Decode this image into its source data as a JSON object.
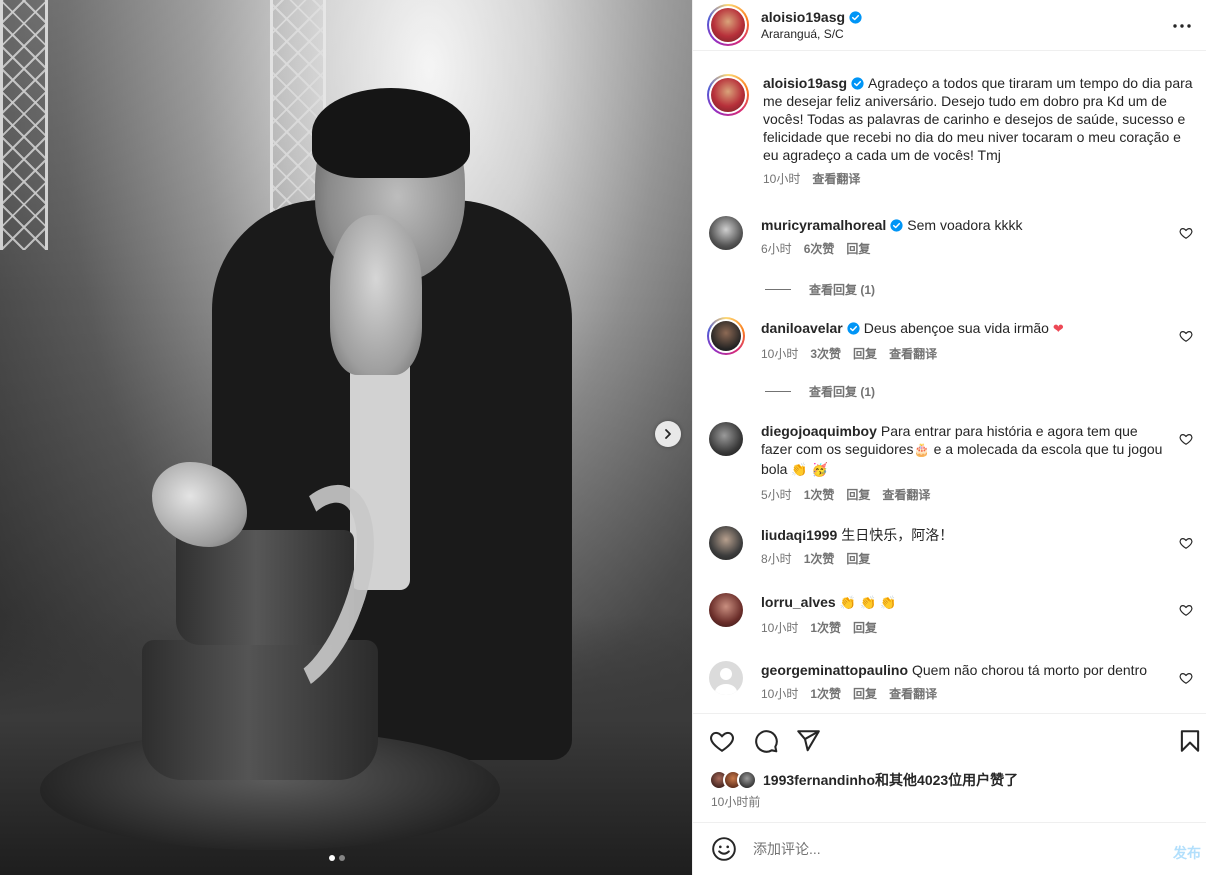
{
  "post": {
    "username": "aloisio19asg",
    "location": "Araranguá, S/C",
    "caption": "Agradeço a todos que tiraram um tempo do dia para me desejar feliz aniversário. Desejo tudo em dobro pra Kd um de vocês! Todas as palavras de carinho e desejos de saúde, sucesso e felicidade que recebi no dia do meu niver tocaram o meu coração e eu agradeço a cada um de vocês! Tmj",
    "caption_time": "10小时",
    "caption_translate": "查看翻译"
  },
  "comments": [
    {
      "user": "muricyramalhoreal",
      "verified": true,
      "text": "Sem voadora kkkk",
      "time": "6小时",
      "likes": "6次赞",
      "reply": "回复",
      "translate": "",
      "view_replies": "查看回复 (1)"
    },
    {
      "user": "daniloavelar",
      "verified": true,
      "text": "Deus abençoe sua vida irmão",
      "emoji": "❤",
      "time": "10小时",
      "likes": "3次赞",
      "reply": "回复",
      "translate": "查看翻译",
      "view_replies": "查看回复 (1)"
    },
    {
      "user": "diegojoaquimboy",
      "verified": false,
      "text_a": "Para entrar para história e agora tem que fazer com os seguidores",
      "emoji_a": "🎂",
      "text_b": " e a molecada da escola que tu jogou bola",
      "emoji_b": "👏 🥳",
      "time": "5小时",
      "likes": "1次赞",
      "reply": "回复",
      "translate": "查看翻译"
    },
    {
      "user": "liudaqi1999",
      "verified": false,
      "text": "生日快乐，阿洛！",
      "time": "8小时",
      "likes": "1次赞",
      "reply": "回复",
      "translate": ""
    },
    {
      "user": "lorru_alves",
      "verified": false,
      "text": "",
      "emoji": "👏 👏 👏",
      "time": "10小时",
      "likes": "1次赞",
      "reply": "回复",
      "translate": ""
    },
    {
      "user": "georgeminattopaulino",
      "verified": false,
      "text": "Quem não chorou tá morto por dentro",
      "time": "10小时",
      "likes": "1次赞",
      "reply": "回复",
      "translate": "查看翻译"
    }
  ],
  "likes": {
    "text": "1993fernandinho和其他4023位用户赞了",
    "time": "10小时前"
  },
  "composer": {
    "placeholder": "添加评论...",
    "post_label": "发布"
  },
  "carousel": {
    "count": 2,
    "active": 1
  },
  "icons": {
    "more": "more-horizontal-icon",
    "like": "heart-icon",
    "comment": "comment-icon",
    "share": "send-icon",
    "save": "bookmark-icon",
    "emoji": "emoji-icon",
    "next": "chevron-right-icon",
    "verified": "verified-badge-icon"
  },
  "colors": {
    "verified": "#0095f6",
    "link": "#737373",
    "post_disabled": "#b2dffc",
    "heart": "#ed4956"
  }
}
